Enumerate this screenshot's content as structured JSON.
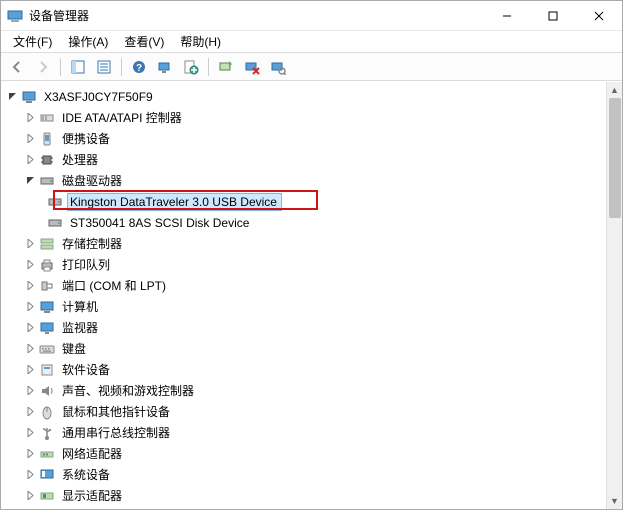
{
  "window": {
    "title": "设备管理器"
  },
  "menu": {
    "file": "文件(F)",
    "action": "操作(A)",
    "view": "查看(V)",
    "help": "帮助(H)"
  },
  "tree": {
    "root": "X3ASFJ0CY7F50F9",
    "cat0": "IDE ATA/ATAPI 控制器",
    "cat1": "便携设备",
    "cat2": "处理器",
    "cat3": "磁盘驱动器",
    "disk0": "Kingston DataTraveler 3.0 USB Device",
    "disk1": "ST350041 8AS SCSI Disk Device",
    "cat4": "存储控制器",
    "cat5": "打印队列",
    "cat6": "端口 (COM 和 LPT)",
    "cat7": "计算机",
    "cat8": "监视器",
    "cat9": "键盘",
    "cat10": "软件设备",
    "cat11": "声音、视频和游戏控制器",
    "cat12": "鼠标和其他指针设备",
    "cat13": "通用串行总线控制器",
    "cat14": "网络适配器",
    "cat15": "系统设备",
    "cat16": "显示适配器"
  },
  "icons": {
    "root": "computer-icon",
    "cat0": "ide-controller-icon",
    "cat1": "portable-device-icon",
    "cat2": "processor-icon",
    "cat3": "disk-drive-icon",
    "disk": "disk-icon",
    "cat4": "storage-controller-icon",
    "cat5": "printer-icon",
    "cat6": "ports-icon",
    "cat7": "computer-icon",
    "cat8": "monitor-icon",
    "cat9": "keyboard-icon",
    "cat10": "software-device-icon",
    "cat11": "sound-icon",
    "cat12": "mouse-icon",
    "cat13": "usb-icon",
    "cat14": "network-icon",
    "cat15": "system-icon",
    "cat16": "display-adapter-icon"
  }
}
